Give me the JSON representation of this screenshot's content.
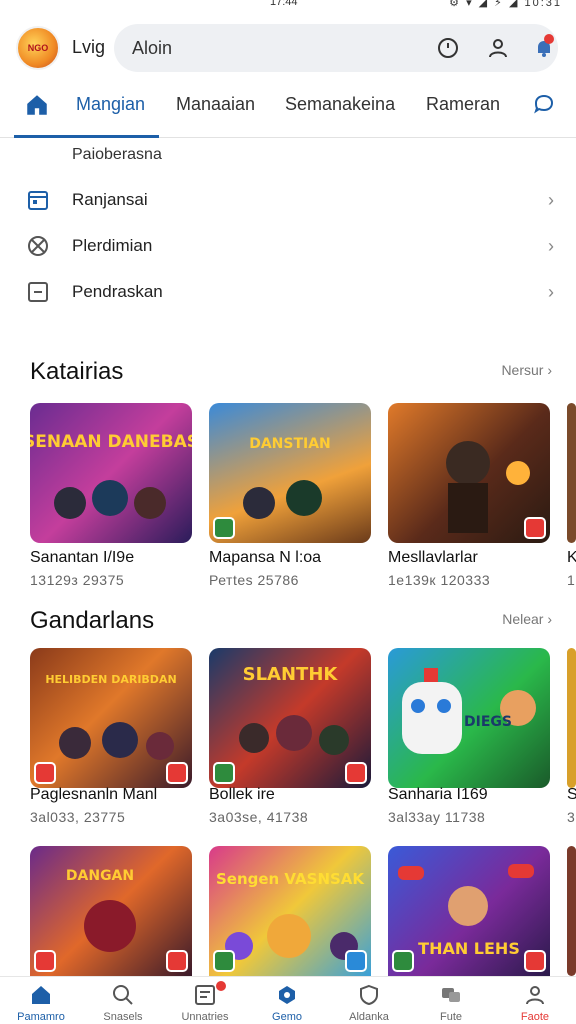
{
  "status_bar": {
    "time": "17:44",
    "right": "⚙ ▾ ◢ ⚡ ◢ 10:31"
  },
  "app": {
    "logo_text": "NGO",
    "name": "Lvig"
  },
  "search": {
    "value": "Aloin"
  },
  "colors": {
    "accent": "#1d5fa8",
    "alert": "#e53935",
    "search_bg": "#eef0f3"
  },
  "tabs": [
    {
      "label": "Mangian",
      "active": true
    },
    {
      "label": "Manaaian"
    },
    {
      "label": "Semanakeina"
    },
    {
      "label": "Rameran"
    }
  ],
  "menu": {
    "subheading": "Paioberasna",
    "items": [
      {
        "label": "Ranjansai",
        "icon": "calendar-icon"
      },
      {
        "label": "Plerdimian",
        "icon": "globe-icon"
      },
      {
        "label": "Pendraskan",
        "icon": "minus-box-icon"
      }
    ]
  },
  "sections": [
    {
      "title": "Katairias",
      "more": "Nersur ›",
      "cards": [
        {
          "art_text": "SENAAN DANEBAS",
          "title": "Sanantan I/I9e",
          "meta": "13129з 29375"
        },
        {
          "art_text": "DANSTIAN",
          "title": "Mapansa N l:oa",
          "meta": "Ретtes 25786"
        },
        {
          "art_text": "",
          "title": "Mesllavlarlar",
          "meta": "1e139к 120333"
        },
        {
          "art_text": "",
          "title": "K",
          "meta": "1"
        }
      ]
    },
    {
      "title": "Gandarlans",
      "more": "Nelear ›",
      "cards": [
        {
          "art_text": "HELIBDEN DARIBDAN",
          "title": "Paglesnanln Manl",
          "meta": "3al033, 23775"
        },
        {
          "art_text": "SLANTHK",
          "title": "Bollek ire",
          "meta": "3a03se, 41738"
        },
        {
          "art_text": "DIEGS",
          "title": "Sanharia I169",
          "meta": "3al33ay 11738"
        },
        {
          "art_text": "",
          "title": "S",
          "meta": "3"
        }
      ]
    },
    {
      "cards": [
        {
          "art_text": "DANGAN"
        },
        {
          "art_text": "Sengen VASNSAK"
        },
        {
          "art_text": "THAN LEHS"
        }
      ]
    }
  ],
  "bottom_nav": [
    {
      "label": "Pamamro",
      "icon": "home-icon",
      "active": true
    },
    {
      "label": "Snasels",
      "icon": "search-icon"
    },
    {
      "label": "Unnatries",
      "icon": "inbox-icon",
      "dot": true
    },
    {
      "label": "Gemo",
      "icon": "gamepad-icon",
      "active": true
    },
    {
      "label": "Aldanka",
      "icon": "shield-icon"
    },
    {
      "label": "Fute",
      "icon": "chat-bubble-icon"
    },
    {
      "label": "Faote",
      "icon": "profile-icon",
      "red": true
    }
  ]
}
